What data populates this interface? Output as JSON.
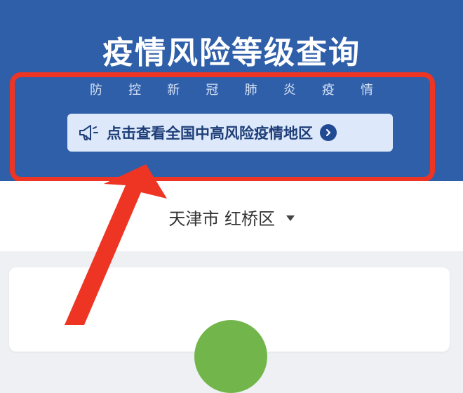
{
  "header": {
    "title": "疫情风险等级查询",
    "subtitle_chars": [
      "防",
      "控",
      "新",
      "冠",
      "肺",
      "炎",
      "疫",
      "情"
    ],
    "cta_label": "点击查看全国中高风险疫情地区",
    "icons": {
      "cta_left": "megaphone-icon",
      "cta_right": "chevron-right-icon"
    }
  },
  "location": {
    "city": "天津市",
    "district": "红桥区",
    "dropdown_icon": "caret-down-icon"
  },
  "colors": {
    "header_blue": "#2f5fa9",
    "cta_bg": "#dde9fb",
    "cta_text": "#1f3e78",
    "annotation_red": "#ee3524",
    "status_green": "#72b64b"
  }
}
